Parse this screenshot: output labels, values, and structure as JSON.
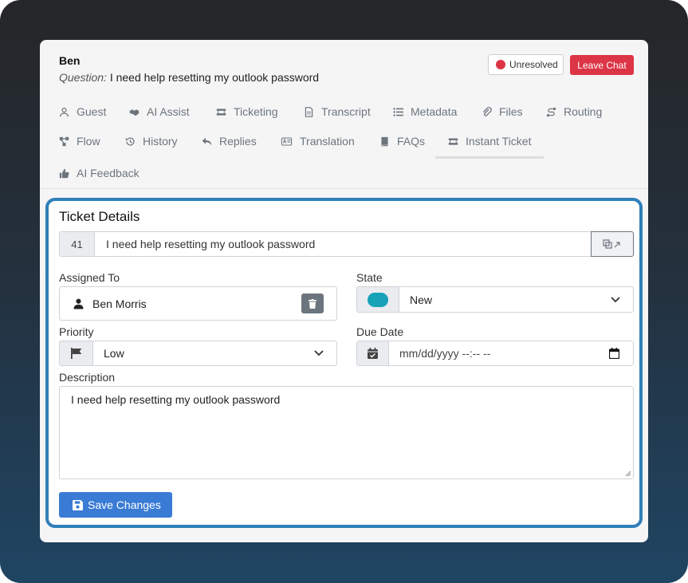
{
  "header": {
    "guest_name": "Ben",
    "question_label": "Question:",
    "question_text": "I need help resetting my outlook password",
    "status_label": "Unresolved",
    "leave_label": "Leave Chat"
  },
  "tabs": [
    {
      "label": "Guest",
      "icon": "user-icon"
    },
    {
      "label": "AI Assist",
      "icon": "handshake-icon"
    },
    {
      "label": "Ticketing",
      "icon": "ticket-icon"
    },
    {
      "label": "Transcript",
      "icon": "file-icon"
    },
    {
      "label": "Metadata",
      "icon": "list-icon"
    },
    {
      "label": "Files",
      "icon": "paperclip-icon"
    },
    {
      "label": "Routing",
      "icon": "route-icon"
    },
    {
      "label": "Flow",
      "icon": "flow-icon"
    },
    {
      "label": "History",
      "icon": "history-icon"
    },
    {
      "label": "Replies",
      "icon": "reply-icon"
    },
    {
      "label": "Translation",
      "icon": "translate-icon"
    },
    {
      "label": "FAQs",
      "icon": "book-icon"
    },
    {
      "label": "Instant Ticket",
      "icon": "ticket-icon",
      "active": true
    },
    {
      "label": "AI Feedback",
      "icon": "thumbs-up-icon"
    }
  ],
  "ticket": {
    "section_title": "Ticket Details",
    "id": "41",
    "title": "I need help resetting my outlook password",
    "assigned_label": "Assigned To",
    "assigned_to": "Ben Morris",
    "state_label": "State",
    "state_value": "New",
    "priority_label": "Priority",
    "priority_value": "Low",
    "due_label": "Due Date",
    "due_placeholder": "mm/dd/yyyy --:-- --",
    "description_label": "Description",
    "description": "I need help resetting my outlook password",
    "save_label": "Save Changes"
  },
  "colors": {
    "accent": "#3a7bd5",
    "danger": "#dc3545",
    "state": "#17a2b8",
    "panel_border": "#2f7fb9"
  }
}
